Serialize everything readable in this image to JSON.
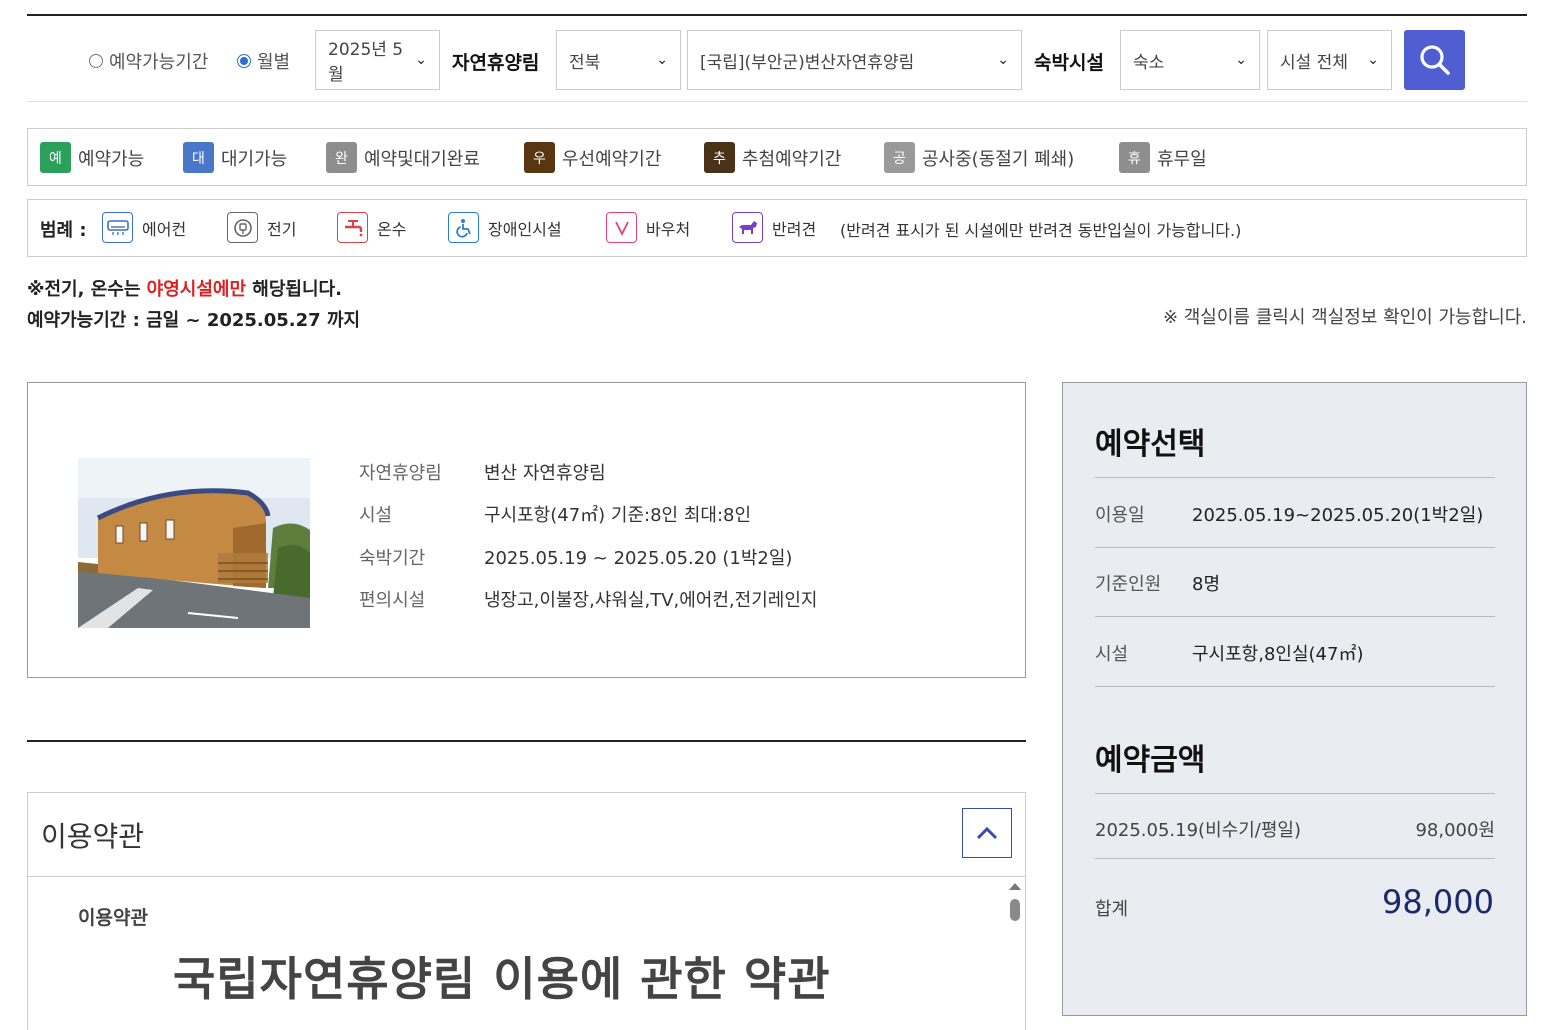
{
  "search": {
    "radio_period": "예약가능기간",
    "radio_monthly": "월별",
    "month": "2025년 5월",
    "forest_label": "자연휴양림",
    "region": "전북",
    "forest": "[국립](부안군)변산자연휴양림",
    "lodging_label": "숙박시설",
    "lodging_type": "숙소",
    "facility": "시설 전체"
  },
  "status_legend": [
    {
      "badge": "예",
      "label": "예약가능",
      "color": "#2aa05a"
    },
    {
      "badge": "대",
      "label": "대기가능",
      "color": "#4a78c8"
    },
    {
      "badge": "완",
      "label": "예약및대기완료",
      "color": "#8e8e8e"
    },
    {
      "badge": "우",
      "label": "우선예약기간",
      "color": "#5a3512"
    },
    {
      "badge": "추",
      "label": "추첨예약기간",
      "color": "#4a3218"
    },
    {
      "badge": "공",
      "label": "공사중(동절기 폐쇄)",
      "color": "#9a9a9a"
    },
    {
      "badge": "휴",
      "label": "휴무일",
      "color": "#8e8e8e"
    }
  ],
  "facility_legend": {
    "title": "범례 :",
    "items": [
      {
        "icon": "air-conditioner-icon",
        "label": "에어컨",
        "color": "#3a6fc4"
      },
      {
        "icon": "electric-plug-icon",
        "label": "전기",
        "color": "#666666"
      },
      {
        "icon": "hot-water-faucet-icon",
        "label": "온수",
        "color": "#e0404a"
      },
      {
        "icon": "wheelchair-icon",
        "label": "장애인시설",
        "color": "#2b7fd0"
      },
      {
        "icon": "voucher-v-icon",
        "label": "바우처",
        "color": "#e0407a"
      },
      {
        "icon": "pet-dog-icon",
        "label": "반려견",
        "color": "#7a3ec8"
      }
    ],
    "note": "(반려견 표시가 된 시설에만 반려견 동반입실이 가능합니다.)"
  },
  "notes": {
    "prefix": "※전기, 온수는 ",
    "highlight": "야영시설에만",
    "suffix": " 해당됩니다.",
    "period": "예약가능기간 : 금일 ~ 2025.05.27 까지",
    "room_info": "※ 객실이름 클릭시 객실정보 확인이 가능합니다."
  },
  "info": {
    "rows": [
      {
        "k": "자연휴양림",
        "v": "변산 자연휴양림"
      },
      {
        "k": "시설",
        "v": "구시포항(47㎡) 기준:8인 최대:8인"
      },
      {
        "k": "숙박기간",
        "v": "2025.05.19 ~ 2025.05.20 (1박2일)"
      },
      {
        "k": "편의시설",
        "v": "냉장고,이불장,샤워실,TV,에어컨,전기레인지"
      }
    ]
  },
  "terms": {
    "title": "이용약관",
    "sub": "이용약관",
    "heading": "국립자연휴양림 이용에 관한 약관"
  },
  "reservation": {
    "title": "예약선택",
    "rows": [
      {
        "k": "이용일",
        "v": "2025.05.19~2025.05.20(1박2일)"
      },
      {
        "k": "기준인원",
        "v": "8명"
      },
      {
        "k": "시설",
        "v": "구시포항,8인실(47㎡)"
      }
    ],
    "amount_title": "예약금액",
    "price_date": "2025.05.19(비수기/평일)",
    "price": "98,000원",
    "total_label": "합계",
    "total": "98,000"
  }
}
